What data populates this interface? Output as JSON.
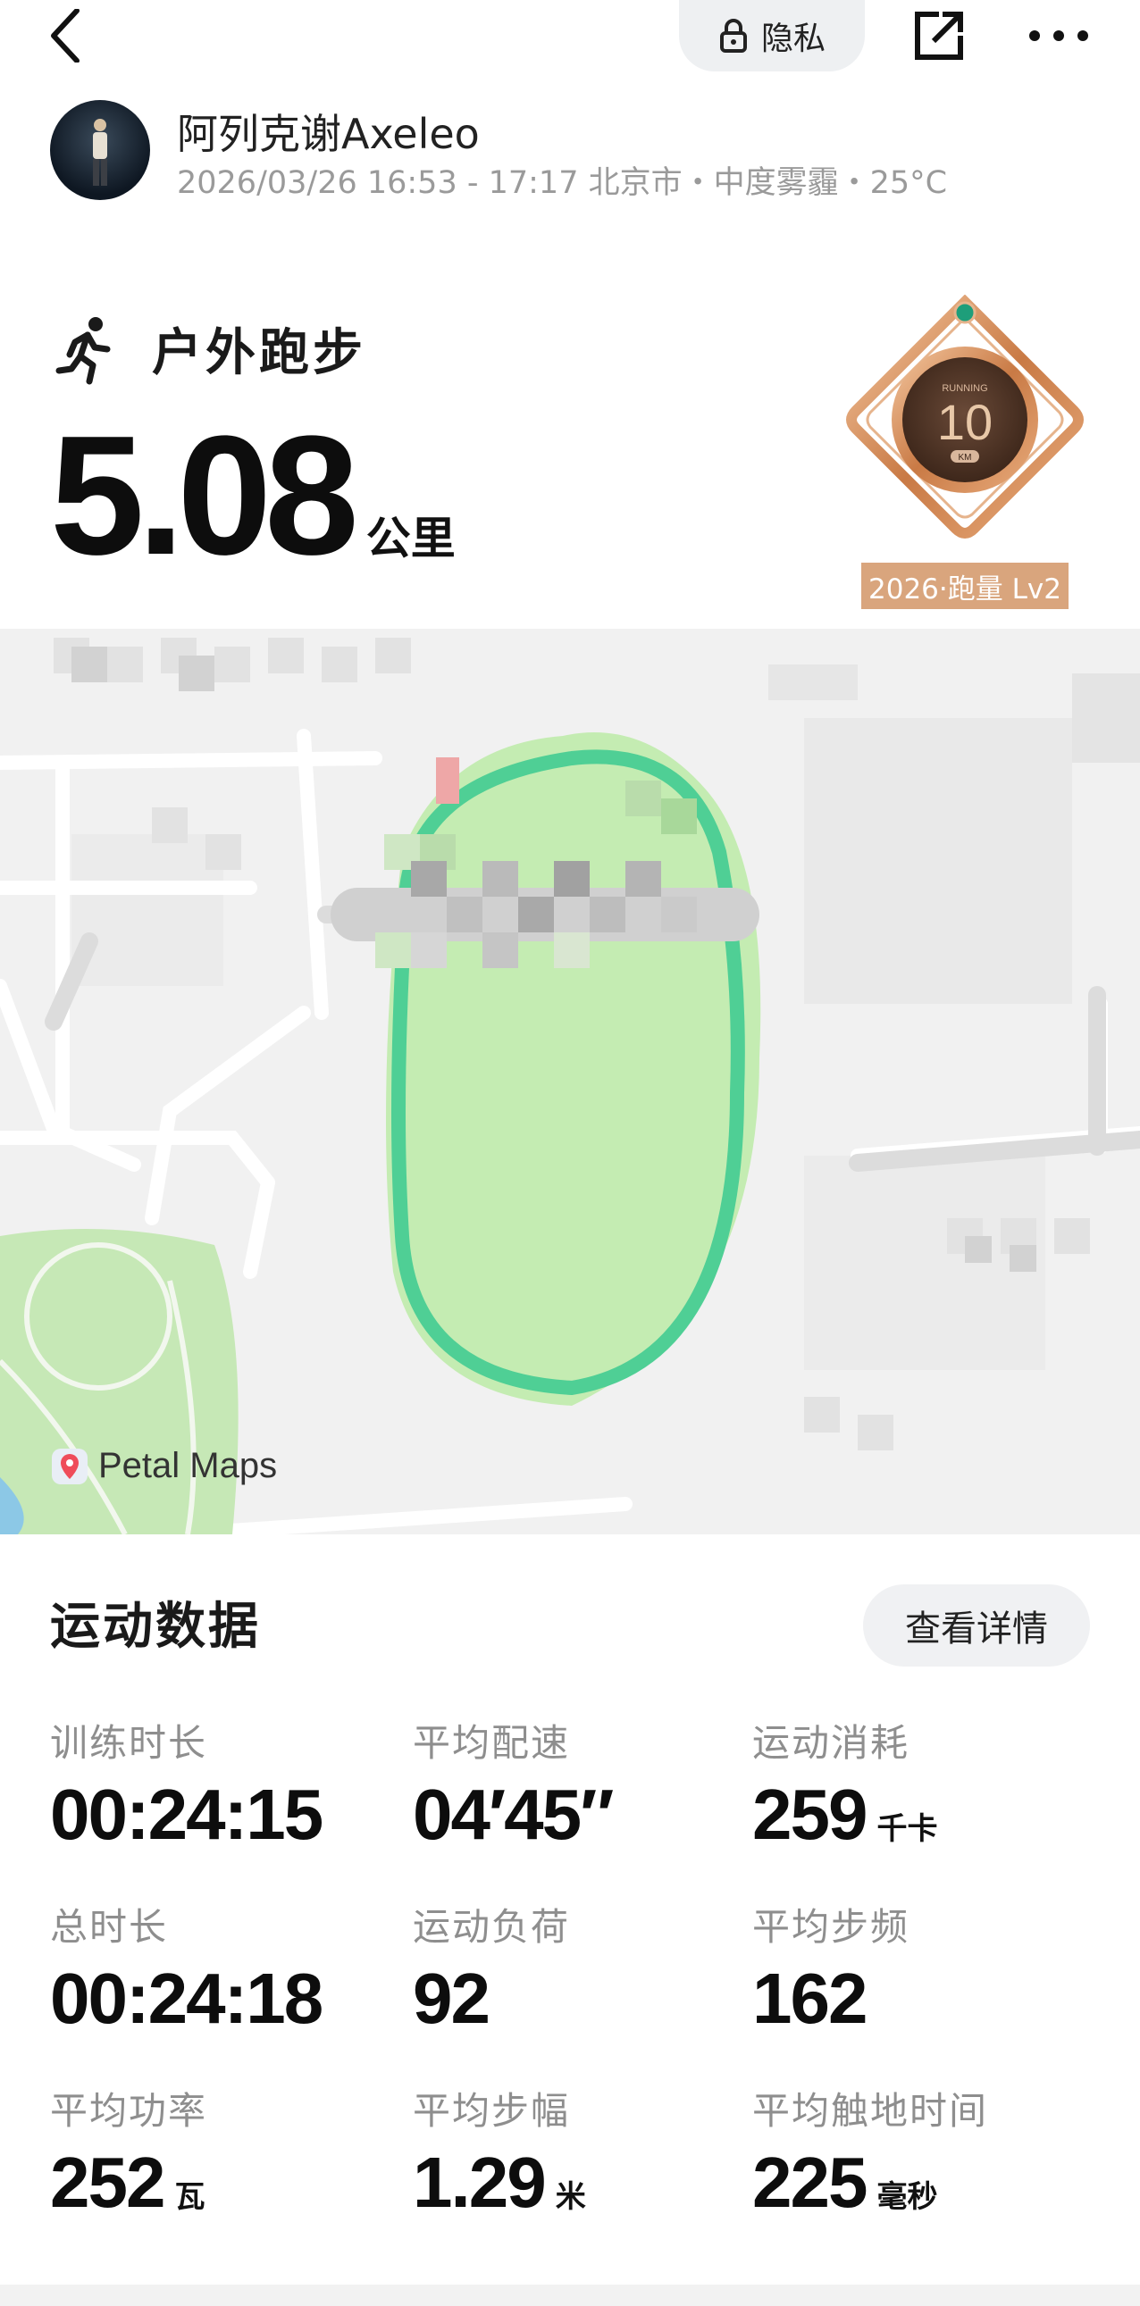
{
  "header": {
    "privacy_label": "隐私"
  },
  "user": {
    "name": "阿列克谢Axeleo",
    "meta": "2026/03/26  16:53 - 17:17 北京市・中度雾霾・25°C"
  },
  "activity": {
    "name": "户外跑步",
    "distance_value": "5.08",
    "distance_unit": "公里"
  },
  "medal": {
    "face_top": "RUNNING",
    "face_number": "10",
    "face_unit": "KM",
    "label": "2026·跑量 Lv2"
  },
  "map": {
    "brand": "Petal Maps"
  },
  "stats": {
    "title": "运动数据",
    "details_button": "查看详情",
    "items": [
      {
        "label": "训练时长",
        "value": "00:24:15",
        "unit": ""
      },
      {
        "label": "平均配速",
        "value": "04′45″",
        "unit": ""
      },
      {
        "label": "运动消耗",
        "value": "259",
        "unit": "千卡"
      },
      {
        "label": "总时长",
        "value": "00:24:18",
        "unit": ""
      },
      {
        "label": "运动负荷",
        "value": "92",
        "unit": ""
      },
      {
        "label": "平均步频",
        "value": "162",
        "unit": ""
      },
      {
        "label": "平均功率",
        "value": "252",
        "unit": "瓦"
      },
      {
        "label": "平均步幅",
        "value": "1.29",
        "unit": "米"
      },
      {
        "label": "平均触地时间",
        "value": "225",
        "unit": "毫秒"
      }
    ]
  },
  "colors": {
    "track": "#4fcf95",
    "field": "#c4ecb2",
    "medal_label_bg": "#d9a57d"
  }
}
